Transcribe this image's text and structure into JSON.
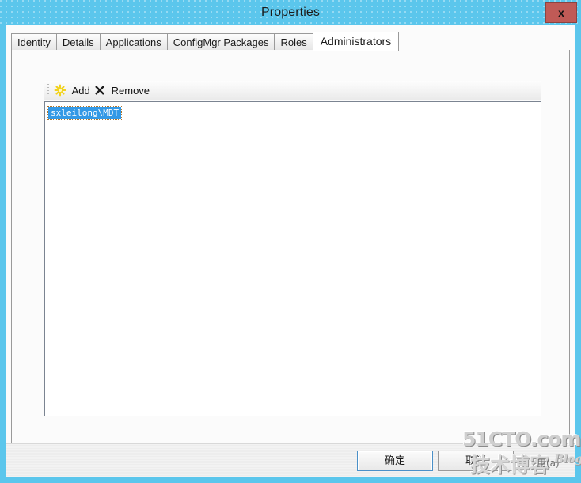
{
  "window": {
    "title": "Properties",
    "close_label": "x",
    "titlebar_color": "#5bc6ec",
    "close_button_color": "#c05a56"
  },
  "tabs": [
    {
      "label": "Identity",
      "active": false
    },
    {
      "label": "Details",
      "active": false
    },
    {
      "label": "Applications",
      "active": false
    },
    {
      "label": "ConfigMgr Packages",
      "active": false
    },
    {
      "label": "Roles",
      "active": false
    },
    {
      "label": "Administrators",
      "active": true
    }
  ],
  "toolbar": {
    "add_label": "Add",
    "add_icon": "yellow-asterisk-icon",
    "remove_label": "Remove",
    "remove_icon": "black-x-icon",
    "grip": "drag-grip-handle"
  },
  "list": {
    "items": [
      {
        "label": "sxleilong\\MDT",
        "selected": true
      }
    ],
    "selection_color": "#3399e6"
  },
  "buttons": {
    "ok_label": "确定",
    "cancel_label": "取消"
  },
  "watermark": {
    "top": "51CTO.com",
    "middle": "技术博客",
    "small_cn": "用(a)",
    "small_en": "Blog"
  }
}
